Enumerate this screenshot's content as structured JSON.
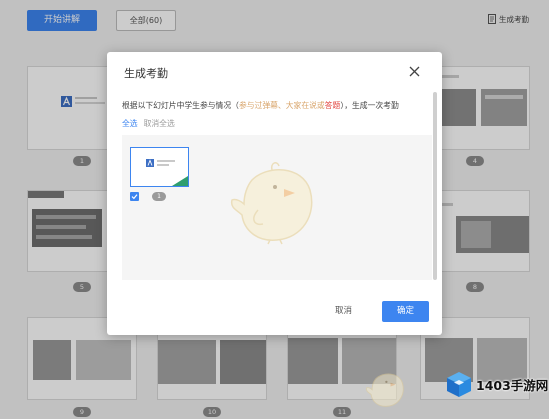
{
  "toolbar": {
    "start_label": "开始讲解",
    "filter_label": "全部(60)",
    "attendance_label": "生成考勤",
    "attendance_icon": "attendance-icon"
  },
  "slides": [
    {
      "badge": "1"
    },
    {
      "badge": "4"
    },
    {
      "badge": "5"
    },
    {
      "badge": "8"
    },
    {
      "badge": "9"
    },
    {
      "badge": "10"
    },
    {
      "badge": "11"
    }
  ],
  "modal": {
    "title": "生成考勤",
    "close_icon": "close-icon",
    "description": {
      "before": "根据以下幻灯片中学生参与情况（",
      "muted": "参与过弹幕、大家在说或",
      "highlight": "答题",
      "after": "），生成一次考勤"
    },
    "select_all_label": "全选",
    "deselect_all_label": "取消全选",
    "slides": [
      {
        "number": "1",
        "checked": true
      }
    ],
    "cancel_label": "取消",
    "confirm_label": "确定"
  },
  "watermark": {
    "brand": "1403手游网"
  },
  "colors": {
    "primary": "#3d85f0",
    "danger": "#e0403a",
    "muted": "#d8a46a",
    "badge": "#8c8c8c"
  }
}
